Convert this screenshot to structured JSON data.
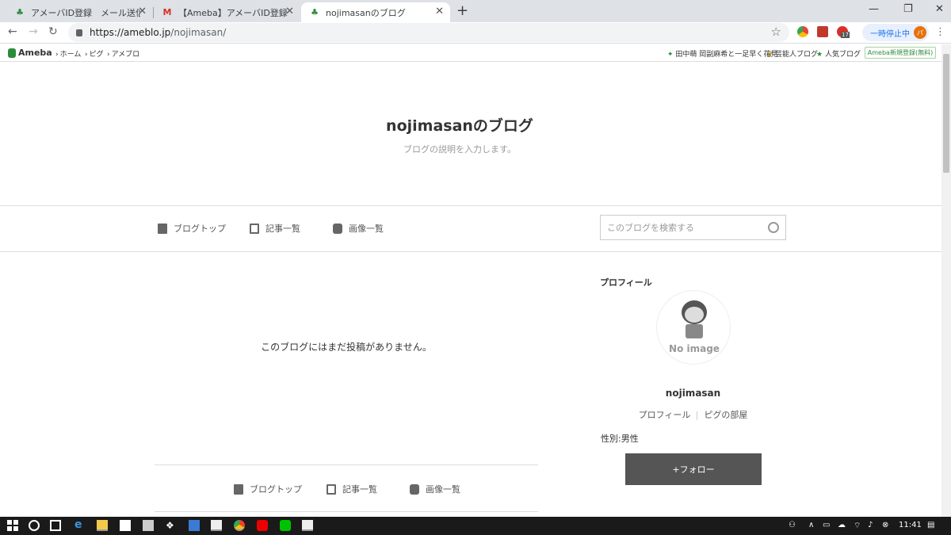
{
  "browser": {
    "tabs": [
      {
        "title": "アメーバID登録　メール送信完了 | Amb",
        "icon": "ameba-icon"
      },
      {
        "title": "【Ameba】アメーバID登録のご案内 -",
        "icon": "gmail-icon"
      },
      {
        "title": "nojimasanのブログ",
        "icon": "ameba-icon"
      }
    ],
    "close": "✕",
    "new_tab": "+",
    "url_host": "https://ameblo.jp",
    "url_path": "/nojimasan/",
    "profile_status": "一時停止中",
    "profile_initial": "パ",
    "ext_badge": "17"
  },
  "ameba_bar": {
    "logo": "Ameba",
    "crumbs": [
      "ホーム",
      "ピグ",
      "アメブロ"
    ],
    "right_links": [
      "田中萌 岡副麻希と一足早く花見",
      "芸能人ブログ",
      "人気ブログ"
    ],
    "register": "Ameba新規登録(無料)"
  },
  "blog": {
    "title": "nojimasanのブログ",
    "description": "ブログの説明を入力します。",
    "nav": [
      "ブログトップ",
      "記事一覧",
      "画像一覧"
    ],
    "search_placeholder": "このブログを検索する",
    "empty_message": "このブログにはまだ投稿がありません。"
  },
  "profile": {
    "heading": "プロフィール",
    "avatar_text": "No image",
    "name": "nojimasan",
    "link_profile": "プロフィール",
    "link_room": "ピグの部屋",
    "gender": "性別:男性",
    "follow": "+フォロー"
  },
  "taskbar": {
    "time": "11:41"
  },
  "colors": {
    "ameba_green": "#2d8c3c",
    "follow_button": "#555555"
  }
}
